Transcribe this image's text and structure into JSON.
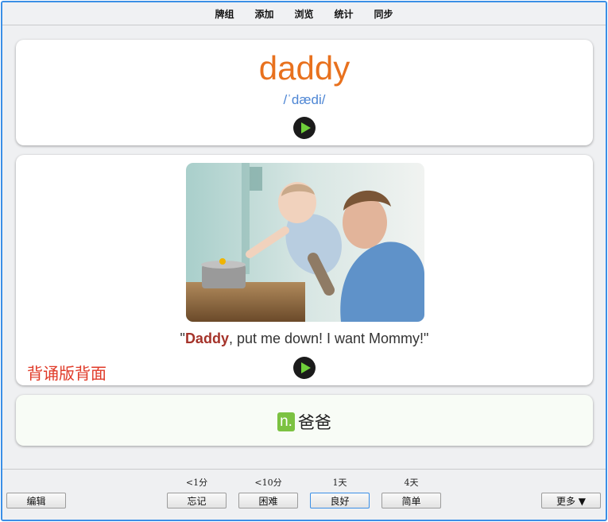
{
  "menu": [
    "牌组",
    "添加",
    "浏览",
    "统计",
    "同步"
  ],
  "card": {
    "word": "daddy",
    "phonetic": "/ˈdædi/",
    "sentence": {
      "quote_open": "\"",
      "highlight": "Daddy",
      "rest": ", put me down! I want Mommy!\""
    },
    "label": "背诵版背面",
    "pos": "n.",
    "meaning": "爸爸"
  },
  "bottom": {
    "edit": "编辑",
    "more": "更多 ▼",
    "answers": [
      {
        "label": "忘记",
        "interval": "<1分"
      },
      {
        "label": "困难",
        "interval": "<10分"
      },
      {
        "label": "良好",
        "interval": "1天"
      },
      {
        "label": "简单",
        "interval": "4天"
      }
    ]
  },
  "colors": {
    "word": "#e8711e",
    "phonetic": "#4e86d4",
    "highlight": "#a5332a",
    "label": "#e03a28",
    "pos_badge": "#7cc242",
    "window_border": "#3b8fe6"
  },
  "icons": [
    "play-icon"
  ]
}
